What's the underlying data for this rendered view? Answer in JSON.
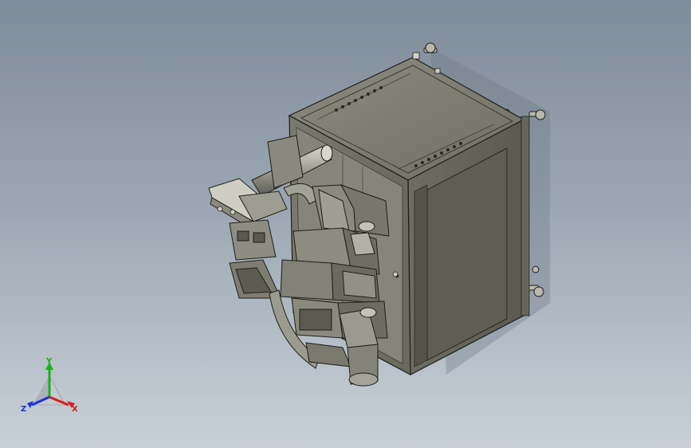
{
  "viewport": {
    "background_top": "#7f8c99",
    "background_bottom": "#c9d0d7"
  },
  "model": {
    "body_color": "#7b7a6e",
    "body_shadow": "#4f4e46",
    "body_highlight": "#a6a598",
    "edge_color": "#1e1e1a"
  },
  "triad": {
    "x_label": "X",
    "y_label": "Y",
    "z_label": "Z",
    "x_color": "#d42020",
    "y_color": "#18b318",
    "z_color": "#2030d8"
  }
}
